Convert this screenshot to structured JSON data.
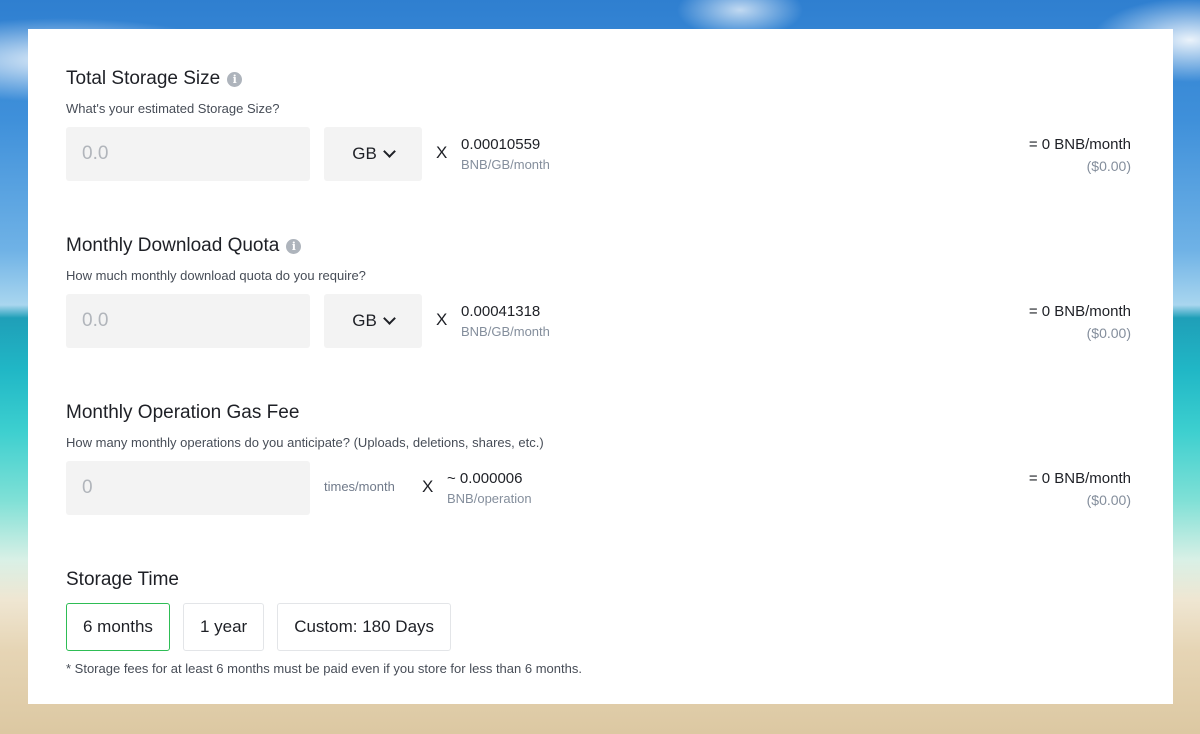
{
  "storage": {
    "title": "Total Storage Size",
    "description": "What's your estimated Storage Size?",
    "input_placeholder": "0.0",
    "unit": "GB",
    "multiply": "X",
    "rate_value": "0.00010559",
    "rate_unit": "BNB/GB/month",
    "result": "= 0 BNB/month",
    "result_usd": "($0.00)"
  },
  "download": {
    "title": "Monthly Download Quota",
    "description": "How much monthly download quota do you require?",
    "input_placeholder": "0.0",
    "unit": "GB",
    "multiply": "X",
    "rate_value": "0.00041318",
    "rate_unit": "BNB/GB/month",
    "result": "= 0 BNB/month",
    "result_usd": "($0.00)"
  },
  "gas": {
    "title": "Monthly Operation Gas Fee",
    "description": "How many monthly operations do you anticipate? (Uploads, deletions, shares, etc.)",
    "input_placeholder": "0",
    "unit_text": "times/month",
    "multiply": "X",
    "rate_value": "~ 0.000006",
    "rate_unit": "BNB/operation",
    "result": "= 0 BNB/month",
    "result_usd": "($0.00)"
  },
  "storage_time": {
    "title": "Storage Time",
    "options": [
      {
        "label": "6 months",
        "selected": true
      },
      {
        "label": "1 year",
        "selected": false
      },
      {
        "label": "Custom: 180 Days",
        "selected": false
      }
    ],
    "note": "* Storage fees for at least 6 months must be paid even if you store for less than 6 months."
  },
  "colors": {
    "selected_border": "#2ebd55",
    "input_bg": "#f3f3f3",
    "muted_text": "#848e9c"
  },
  "icons": [
    "info-icon",
    "chevron-down-icon"
  ]
}
